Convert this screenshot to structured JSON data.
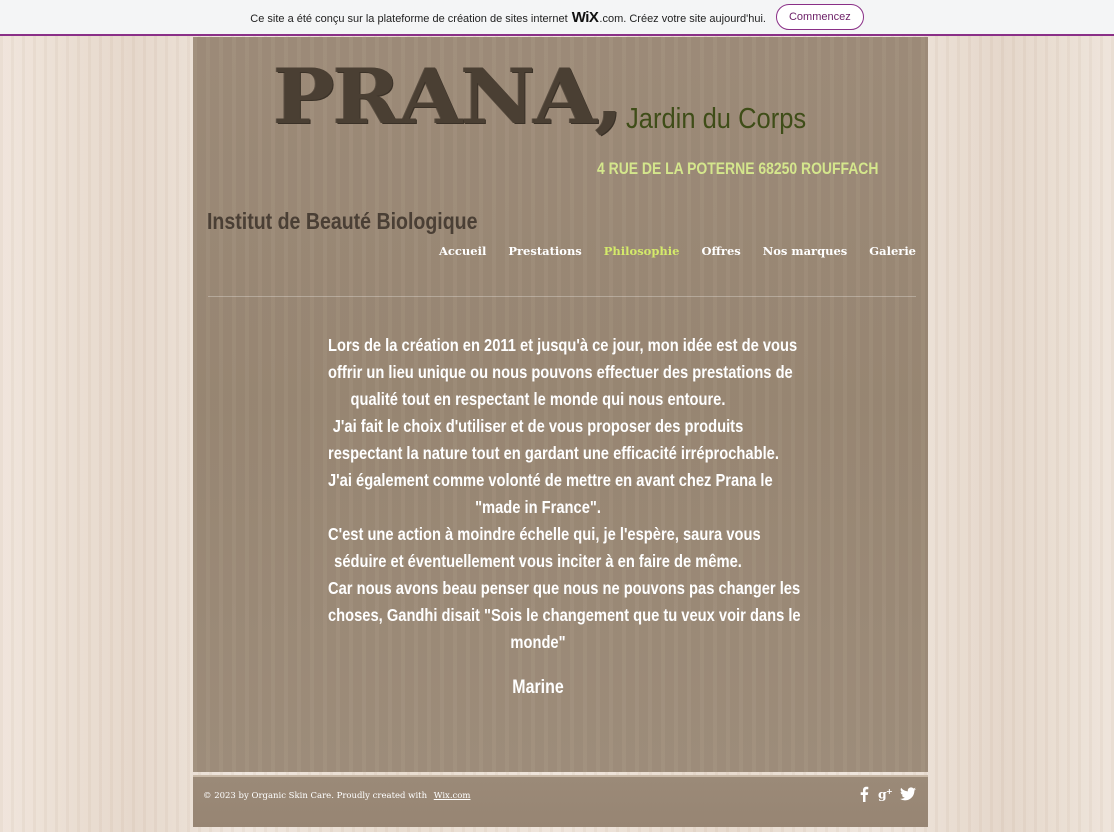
{
  "banner": {
    "text": "Ce site a été conçu sur la plateforme de création de sites internet",
    "brand": "WiX",
    "brand_suffix": ".com. Créez votre site aujourd'hui.",
    "cta": "Commencez"
  },
  "header": {
    "logo": "PRANA,",
    "tagline": "Jardin du Corps",
    "address": "4 RUE DE LA POTERNE 68250 ROUFFACH",
    "subtitle": "Institut de Beauté Biologique"
  },
  "nav": {
    "items": [
      {
        "label": "Accueil"
      },
      {
        "label": "Prestations"
      },
      {
        "label": "Philosophie"
      },
      {
        "label": "Offres"
      },
      {
        "label": "Nos marques"
      },
      {
        "label": "Galerie"
      }
    ],
    "active": "Philosophie"
  },
  "content": {
    "lines": [
      "Lors de la création en 2011 et jusqu'à ce jour, mon idée est de vous",
      "offrir un lieu unique ou nous pouvons effectuer des prestations de",
      "qualité tout en respectant le monde qui nous entoure.",
      "J'ai fait le choix d'utiliser et de vous proposer des produits",
      "respectant la nature tout en gardant une efficacité irréprochable.",
      "J'ai également comme volonté de mettre en avant chez Prana le",
      "\"made in France\".",
      "C'est une action à moindre échelle qui, je l'espère, saura vous",
      "séduire et éventuellement vous inciter à en faire de même.",
      "Car nous avons beau penser que nous ne pouvons pas changer les",
      "choses, Gandhi disait \"Sois le changement que tu veux voir dans le",
      "monde\""
    ],
    "signature": "Marine"
  },
  "footer": {
    "copyright": "© 2023 by Organic Skin Care. Proudly created with",
    "link": "Wix.com",
    "social": [
      {
        "icon": "facebook-icon",
        "glyph": "f"
      },
      {
        "icon": "google-plus-icon",
        "glyph": "g+"
      },
      {
        "icon": "twitter-icon",
        "glyph": "t"
      }
    ]
  },
  "colors": {
    "wix_accent": "#8a2f87",
    "nav_active": "#d4ea6a",
    "tagline": "#3f4d18",
    "address": "#d4e68c"
  }
}
